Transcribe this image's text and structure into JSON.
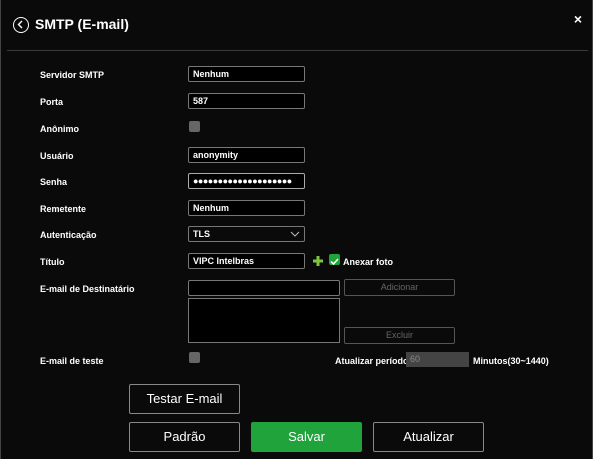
{
  "dialog": {
    "title": "SMTP (E-mail)",
    "close_glyph": "×",
    "back_icon": "back-arrow-icon"
  },
  "form": {
    "smtp_server": {
      "label": "Servidor SMTP",
      "value": "Nenhum"
    },
    "port": {
      "label": "Porta",
      "value": "587"
    },
    "anonymous": {
      "label": "Anônimo",
      "checked": false
    },
    "user": {
      "label": "Usuário",
      "value": "anonymity"
    },
    "password": {
      "label": "Senha",
      "value": "●●●●●●●●●●●●●●●●●●●●"
    },
    "sender": {
      "label": "Remetente",
      "value": "Nenhum"
    },
    "auth": {
      "label": "Autenticação",
      "value": "TLS"
    },
    "subject": {
      "label": "Título",
      "value": "VIPC Intelbras",
      "attach_label": "Anexar foto",
      "attach_checked": true
    },
    "recipient": {
      "label": "E-mail de Destinatário",
      "value": "",
      "add_label": "Adicionar",
      "delete_label": "Excluir"
    },
    "test_email": {
      "label": "E-mail de teste",
      "checked": false,
      "period_label": "Atualizar período",
      "period_value": "60",
      "period_unit": "Minutos(30~1440)"
    }
  },
  "buttons": {
    "test": "Testar E-mail",
    "default": "Padrão",
    "save": "Salvar",
    "refresh": "Atualizar"
  },
  "colors": {
    "accent": "#1fa33a",
    "background": "#0a0a0a",
    "disabled_text": "#666666"
  }
}
